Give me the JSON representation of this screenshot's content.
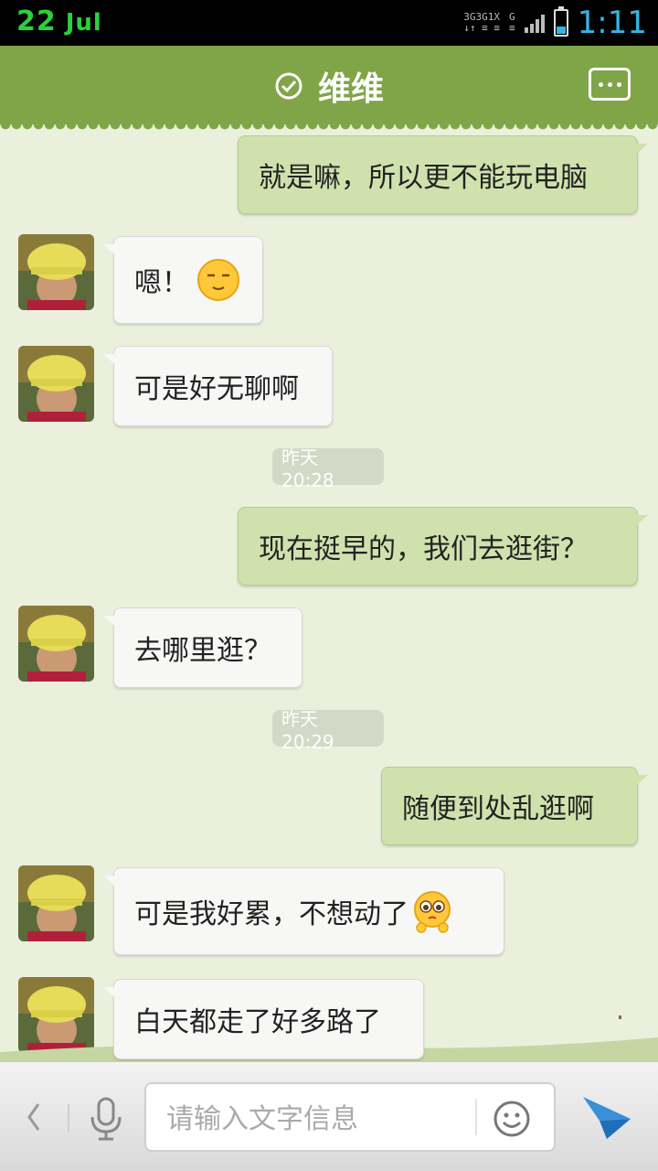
{
  "status_bar": {
    "day": "22",
    "month": "Jul",
    "network_labels": [
      "3G",
      "3G",
      "1X",
      "G"
    ],
    "battery_level": 0.3,
    "time": "1:11",
    "colors": {
      "date": "#29d23a",
      "time": "#33b5e5"
    }
  },
  "header": {
    "title": "维维",
    "verified_icon": "check-circle-icon",
    "menu_icon": "more-dots-icon",
    "color": "#7fa548"
  },
  "messages": [
    {
      "side": "right",
      "text": "就是嘛，所以更不能玩电脑"
    },
    {
      "side": "left",
      "text": "嗯！",
      "emoji": "content-smile-emoji"
    },
    {
      "side": "left",
      "text": "可是好无聊啊"
    },
    {
      "timestamp": "昨天 20:28"
    },
    {
      "side": "right",
      "text": "现在挺早的，我们去逛街？"
    },
    {
      "side": "left",
      "text": "去哪里逛？"
    },
    {
      "timestamp": "昨天 20:29"
    },
    {
      "side": "right",
      "text": "随便到处乱逛啊"
    },
    {
      "side": "left",
      "text": "可是我好累，不想动了",
      "emoji": "teary-emoji"
    },
    {
      "side": "left",
      "text": "白天都走了好多路了"
    }
  ],
  "input_bar": {
    "placeholder": "请输入文字信息",
    "value": "",
    "icons": [
      "back-icon",
      "microphone-icon",
      "smiley-icon",
      "send-icon"
    ]
  }
}
